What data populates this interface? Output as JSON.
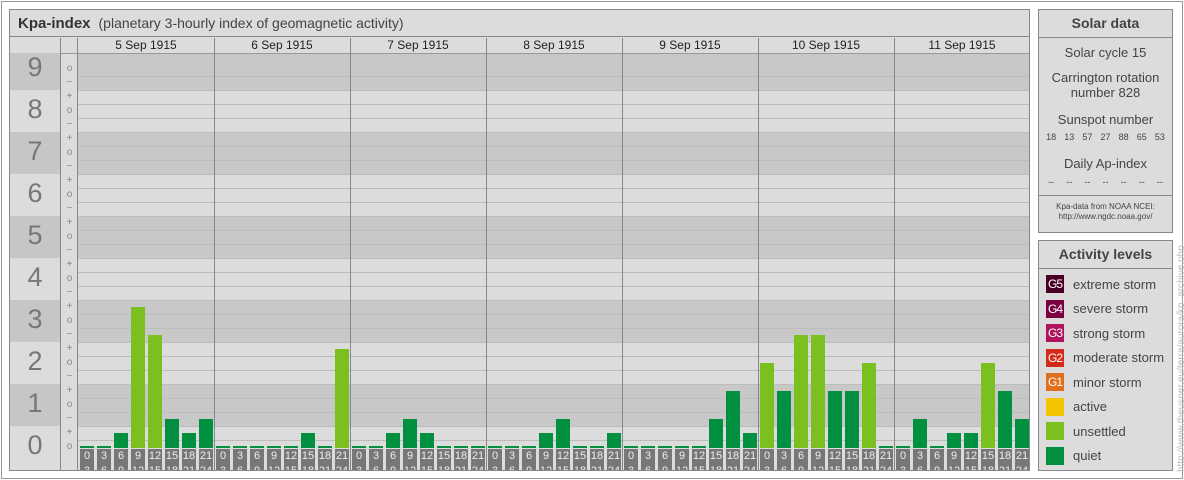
{
  "title": {
    "main": "Kpa-index",
    "sub": "(planetary 3-hourly index of geomagnetic activity)"
  },
  "chart_data": {
    "type": "bar",
    "title": "Kpa-index (planetary 3-hourly index of geomagnetic activity)",
    "ylim": [
      0,
      9
    ],
    "y_labels": [
      "0",
      "1",
      "2",
      "3",
      "4",
      "5",
      "6",
      "7",
      "8",
      "9"
    ],
    "tick_symbols": [
      "o",
      "+",
      "−"
    ],
    "hour_ranges": [
      [
        "0",
        "3"
      ],
      [
        "3",
        "6"
      ],
      [
        "6",
        "9"
      ],
      [
        "9",
        "12"
      ],
      [
        "12",
        "15"
      ],
      [
        "15",
        "18"
      ],
      [
        "18",
        "21"
      ],
      [
        "21",
        "24"
      ]
    ],
    "days": [
      {
        "date": "5 Sep 1915",
        "kp": [
          "0o",
          "0o",
          "0+",
          "3+",
          "3-",
          "1-",
          "0+",
          "1-"
        ]
      },
      {
        "date": "6 Sep 1915",
        "kp": [
          "0o",
          "0o",
          "0o",
          "0o",
          "0o",
          "0+",
          "0o",
          "2+"
        ]
      },
      {
        "date": "7 Sep 1915",
        "kp": [
          "0o",
          "0o",
          "0+",
          "1-",
          "0+",
          "0o",
          "0o",
          "0o"
        ]
      },
      {
        "date": "8 Sep 1915",
        "kp": [
          "0o",
          "0o",
          "0o",
          "0+",
          "1-",
          "0o",
          "0o",
          "0+"
        ]
      },
      {
        "date": "9 Sep 1915",
        "kp": [
          "0o",
          "0o",
          "0o",
          "0o",
          "0o",
          "1-",
          "1+",
          "0+"
        ]
      },
      {
        "date": "10 Sep 1915",
        "kp": [
          "2o",
          "1+",
          "3-",
          "3-",
          "1+",
          "1+",
          "2o",
          "0o"
        ]
      },
      {
        "date": "11 Sep 1915",
        "kp": [
          "0o",
          "1-",
          "0o",
          "0+",
          "0+",
          "2o",
          "1+",
          "1-"
        ]
      }
    ]
  },
  "solar": {
    "title": "Solar data",
    "cycle": "Solar cycle 15",
    "carrington": "Carrington rotation number 828",
    "sunspot_label": "Sunspot number",
    "sunspots": [
      "18",
      "13",
      "57",
      "27",
      "88",
      "65",
      "53"
    ],
    "ap_label": "Daily Ap-index",
    "ap": [
      "--",
      "--",
      "--",
      "--",
      "--",
      "--",
      "--"
    ],
    "source1": "Kpa-data from NOAA NCEI:",
    "source2": "http://www.ngdc.noaa.gov/"
  },
  "levels": {
    "title": "Activity levels",
    "items": [
      {
        "badge": "G5",
        "label": "extreme storm",
        "color": "#4a0024"
      },
      {
        "badge": "G4",
        "label": "severe storm",
        "color": "#7a0040"
      },
      {
        "badge": "G3",
        "label": "strong storm",
        "color": "#b0125e"
      },
      {
        "badge": "G2",
        "label": "moderate storm",
        "color": "#d42a1a"
      },
      {
        "badge": "G1",
        "label": "minor storm",
        "color": "#e0701a"
      },
      {
        "badge": "",
        "label": "active",
        "color": "#f5c400"
      },
      {
        "badge": "",
        "label": "unsettled",
        "color": "#7ac01f"
      },
      {
        "badge": "",
        "label": "quiet",
        "color": "#00903f"
      }
    ]
  },
  "watermark": "http://www.theusner.eu/terra/aurora/kp_archive.php"
}
